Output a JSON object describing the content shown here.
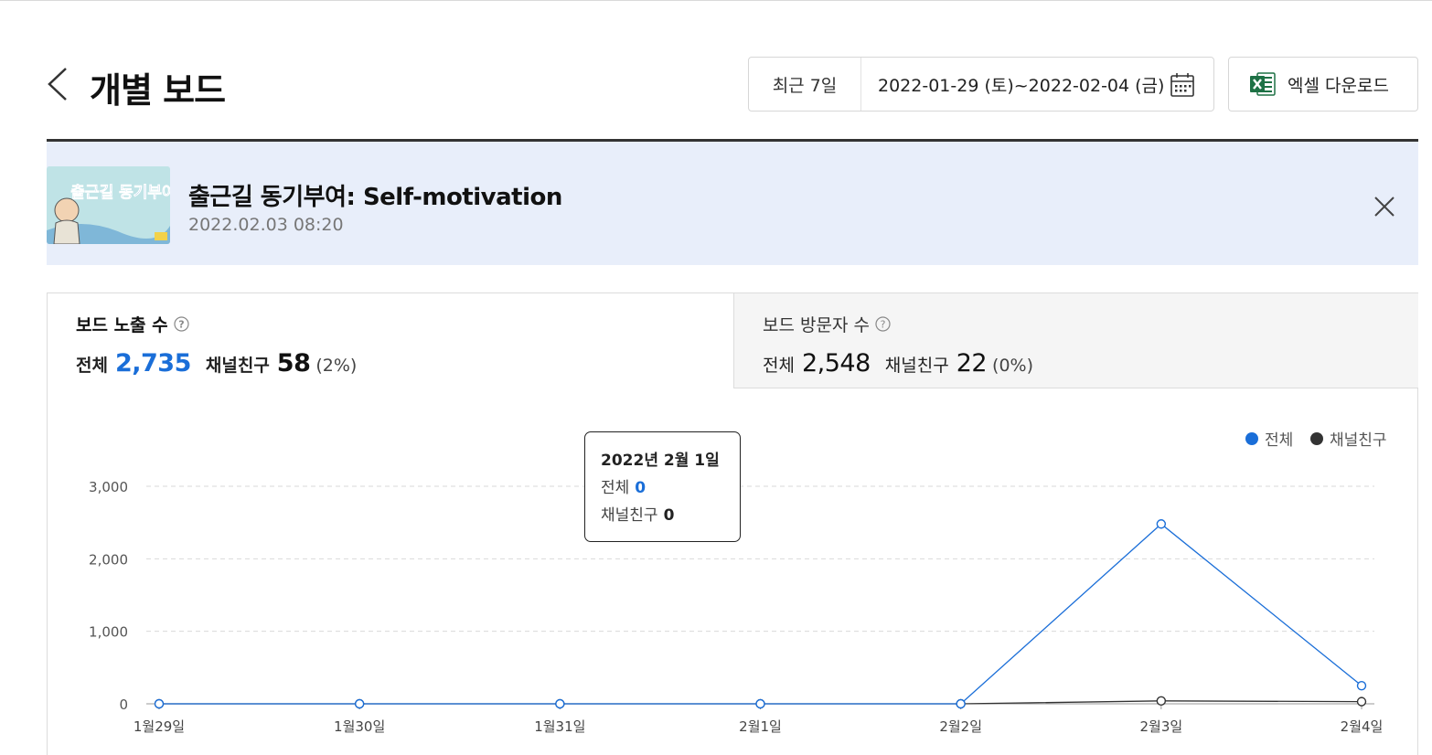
{
  "header": {
    "title": "개별 보드",
    "period_label": "최근 7일",
    "date_range": "2022-01-29 (토)~2022-02-04 (금)",
    "excel_label": "엑셀 다운로드"
  },
  "board": {
    "title": "출근길 동기부여: Self-motivation",
    "posted_at": "2022.02.03 08:20",
    "thumbnail_text": "출근길 동기부여"
  },
  "tabs": [
    {
      "label": "보드 노출 수",
      "total_label": "전체",
      "total_value": "2,735",
      "friends_label": "채널친구",
      "friends_value": "58",
      "friends_pct": "(2%)"
    },
    {
      "label": "보드 방문자 수",
      "total_label": "전체",
      "total_value": "2,548",
      "friends_label": "채널친구",
      "friends_value": "22",
      "friends_pct": "(0%)"
    }
  ],
  "tooltip": {
    "date": "2022년 2월 1일",
    "total_label": "전체",
    "total_value": "0",
    "friends_label": "채널친구",
    "friends_value": "0"
  },
  "colors": {
    "total": "#1a6ed8",
    "friends": "#333333"
  },
  "chart_data": {
    "type": "line",
    "categories": [
      "1월29일",
      "1월30일",
      "1월31일",
      "2월1일",
      "2월2일",
      "2월3일",
      "2월4일"
    ],
    "series": [
      {
        "name": "전체",
        "values": [
          0,
          0,
          0,
          0,
          0,
          2480,
          250
        ]
      },
      {
        "name": "채널친구",
        "values": [
          0,
          0,
          0,
          0,
          0,
          40,
          30
        ]
      }
    ],
    "y_ticks": [
      "3,000",
      "2,000",
      "1,000",
      "0"
    ],
    "y_tick_values": [
      3000,
      2000,
      1000,
      0
    ],
    "ylim": [
      0,
      3000
    ],
    "grid": true,
    "legend_position": "top-right"
  }
}
